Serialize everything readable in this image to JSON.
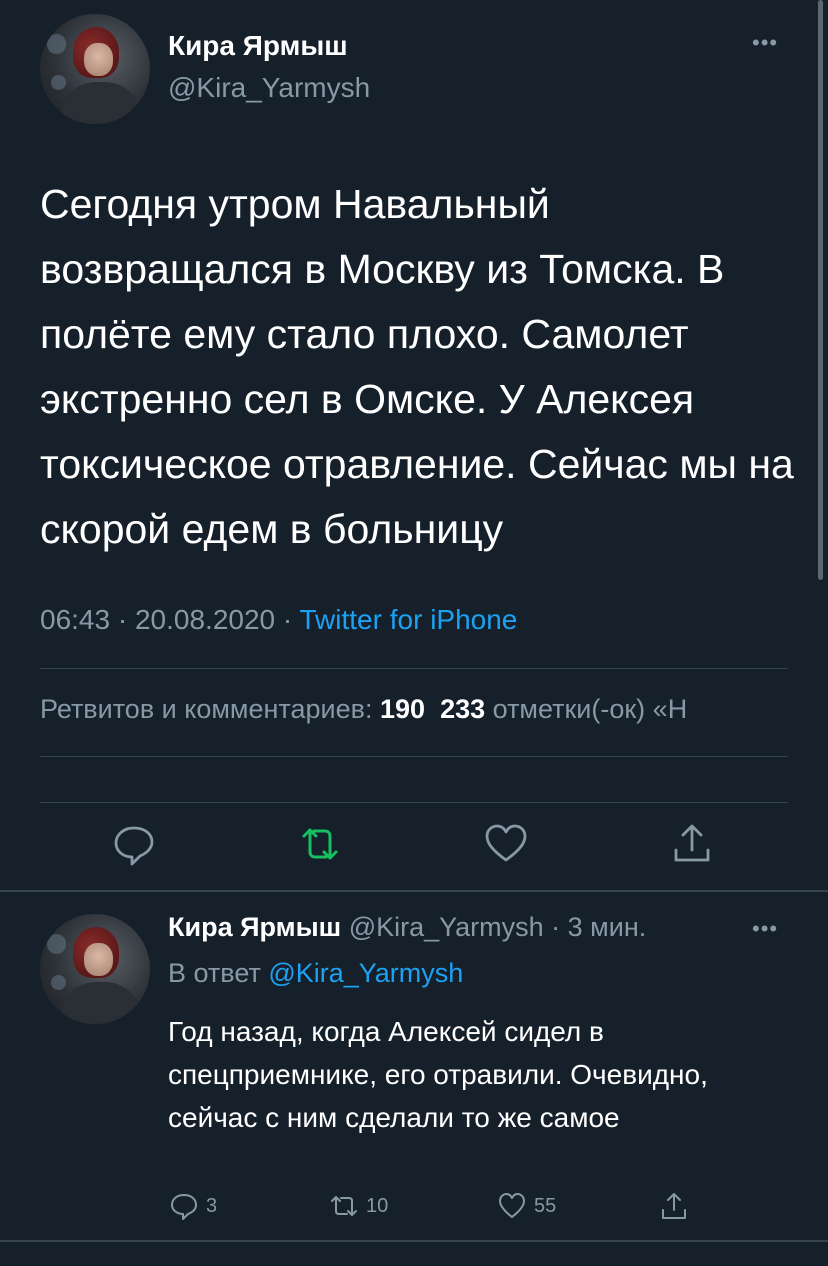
{
  "main_tweet": {
    "author_name": "Кира Ярмыш",
    "author_handle": "@Kira_Yarmysh",
    "more_icon": "more-horizontal-icon",
    "text": "Сегодня утром Навальный возвращался в Москву из Томска. В полёте ему стало плохо. Самолет экстренно сел в Омске. У Алексея токсическое отравление. Сейчас мы на скорой едем в больницу",
    "time": "06:43",
    "date": "20.08.2020",
    "source": "Twitter for iPhone",
    "separator": " · ",
    "stats": {
      "retweets_label": "Ретвитов и комментариев:",
      "retweets_count": "190",
      "likes_count": "233",
      "likes_label": "отметки(-ок) «Н"
    },
    "actions": [
      {
        "name": "reply",
        "icon": "comment-icon"
      },
      {
        "name": "retweet",
        "icon": "retweet-icon",
        "color": "#17bf63"
      },
      {
        "name": "like",
        "icon": "heart-icon"
      },
      {
        "name": "share",
        "icon": "share-icon"
      }
    ]
  },
  "reply_tweet": {
    "author_name": "Кира Ярмыш",
    "author_handle": "@Kira_Yarmysh",
    "time_ago": "3 мин.",
    "separator": " · ",
    "reply_to_label": "В ответ",
    "reply_to_handle": "@Kira_Yarmysh",
    "text": "Год назад, когда Алексей сидел в спецприемнике, его отравили. Очевидно, сейчас с ним сделали то же самое",
    "counts": {
      "replies": "3",
      "retweets": "10",
      "likes": "55"
    }
  },
  "colors": {
    "background": "#15202b",
    "accent": "#1da1f2",
    "secondary_text": "#8899a6",
    "divider": "#38444d",
    "retweet_green": "#17bf63"
  }
}
